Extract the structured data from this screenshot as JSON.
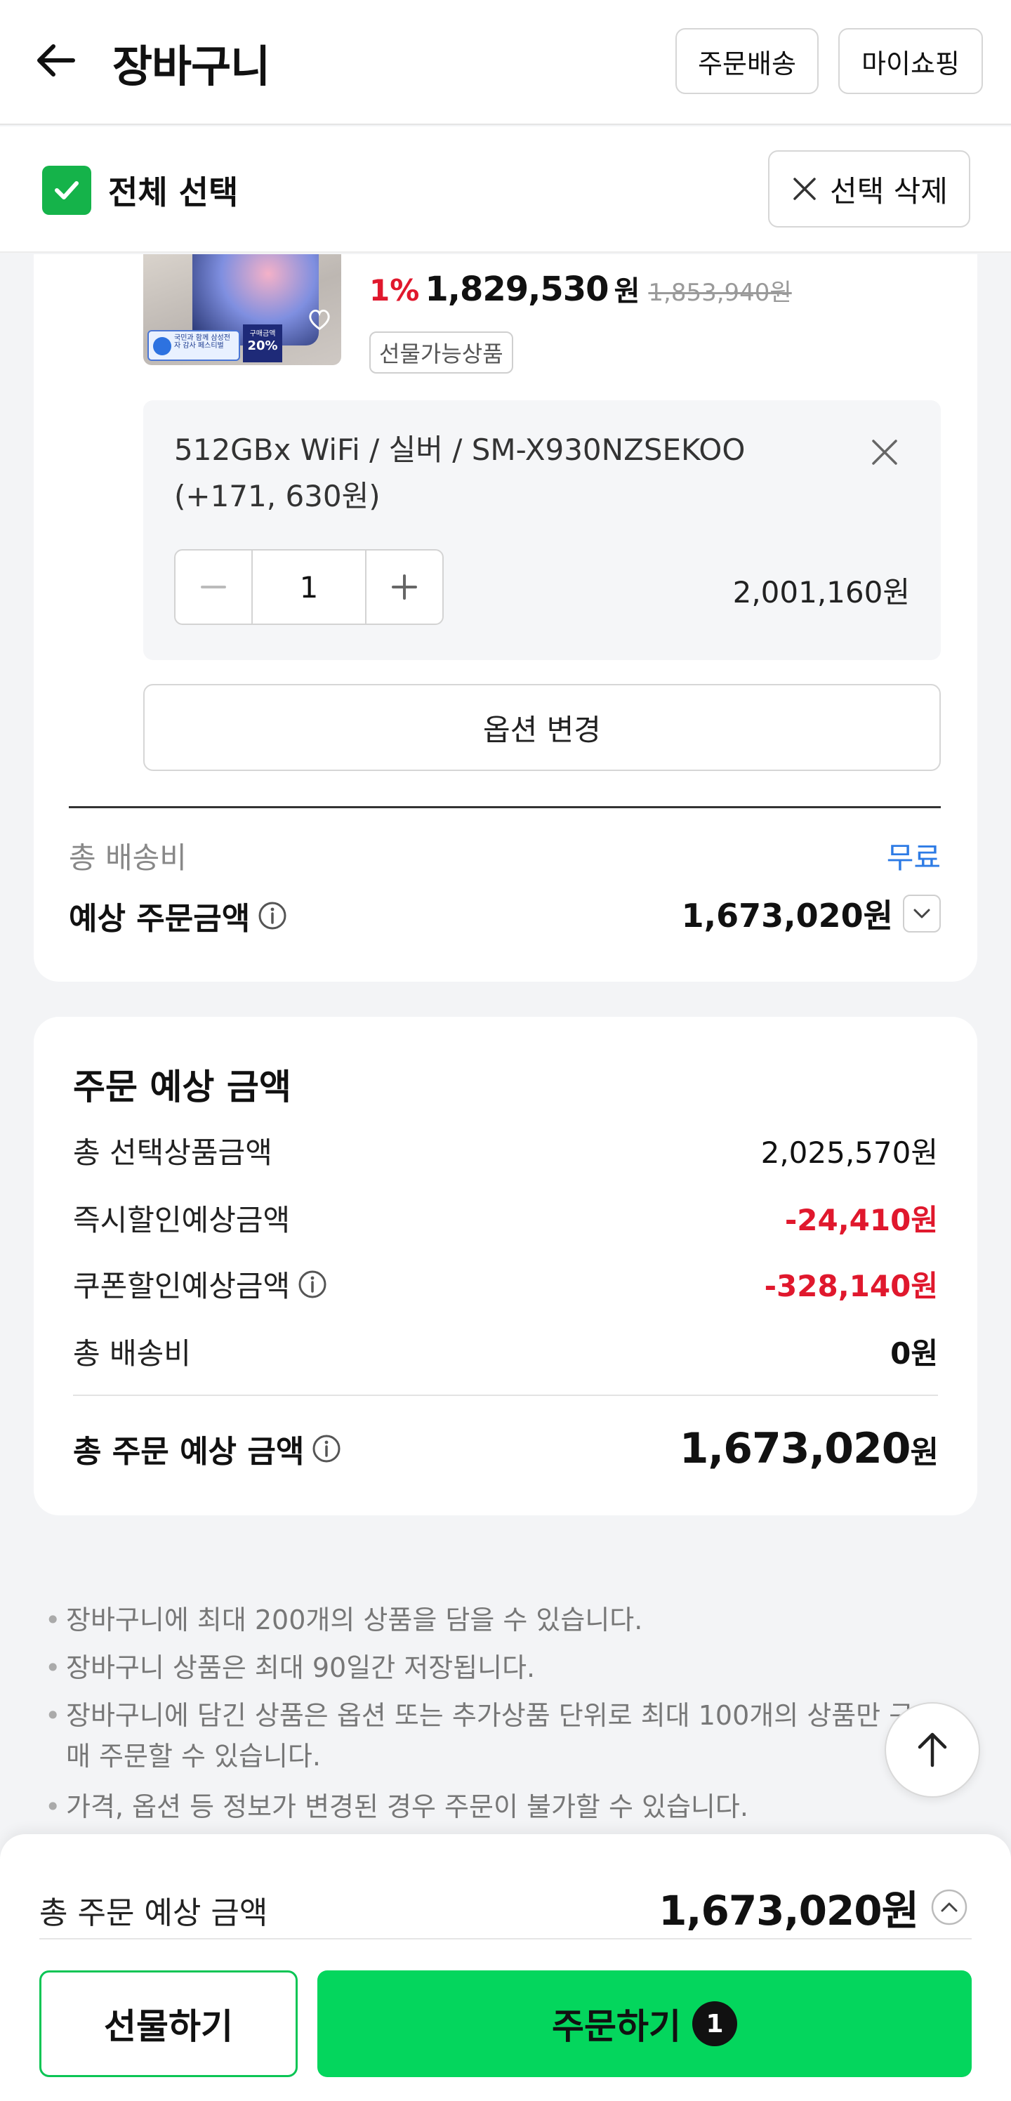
{
  "header": {
    "title": "장바구니",
    "order_delivery_label": "주문배송",
    "my_shopping_label": "마이쇼핑"
  },
  "select_bar": {
    "select_all_label": "전체 선택",
    "select_all_checked": true,
    "delete_selected_label": "선택 삭제"
  },
  "product": {
    "thumbnail_badge_text": "국민과 함께 삼성전자 감사 페스티벌",
    "thumbnail_badge2_top": "구매금액",
    "thumbnail_badge2_pct": "20%",
    "discount_rate": "1%",
    "sale_price": "1,829,530",
    "sale_price_unit": "원",
    "original_price": "1,853,940원",
    "gift_tag": "선물가능상품",
    "option": {
      "text": "512GBx WiFi / 실버 / SM-X930NZSEKOO (+171, 630원)",
      "quantity": "1",
      "price": "2,001,160원"
    },
    "change_option_label": "옵션 변경",
    "shipping_label": "총 배송비",
    "shipping_value": "무료",
    "estimated_label": "예상 주문금액",
    "estimated_value": "1,673,020원"
  },
  "summary": {
    "title": "주문 예상 금액",
    "rows": [
      {
        "label": "총 선택상품금액",
        "value": "2,025,570원"
      },
      {
        "label": "즉시할인예상금액",
        "value": "-24,410원"
      },
      {
        "label": "쿠폰할인예상금액",
        "value": "-328,140원"
      },
      {
        "label": "총 배송비",
        "value": "0원"
      }
    ],
    "total_label": "총 주문 예상 금액",
    "total_value": "1,673,020",
    "total_unit": "원"
  },
  "notices": [
    "장바구니에 최대 200개의 상품을 담을 수 있습니다.",
    "장바구니 상품은 최대 90일간 저장됩니다.",
    "장바구니에 담긴 상품은 옵션 또는 추가상품 단위로 최대 100개의 상품만 구매 주문할 수 있습니다.",
    "가격, 옵션 등 정보가 변경된 경우 주문이 불가할 수 있습니다."
  ],
  "bottom_bar": {
    "total_label": "총 주문 예상 금액",
    "total_value": "1,673,020원",
    "gift_button": "선물하기",
    "order_button": "주문하기",
    "order_count": "1"
  },
  "colors": {
    "accent_green": "#04d65d",
    "check_green": "#15b34a",
    "discount_red": "#e0182d",
    "free_blue": "#2d7be5"
  }
}
